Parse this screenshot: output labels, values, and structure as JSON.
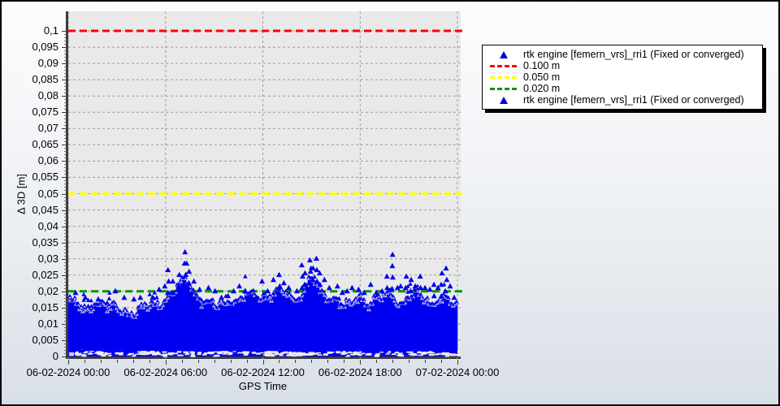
{
  "window": {
    "border_color": "#000000",
    "plot_background": "#e9e9e9",
    "page_background_top": "#fcfdfe",
    "page_background_bottom": "#d9dfe8"
  },
  "chart_data": {
    "type": "scatter",
    "title": "",
    "xlabel": "GPS Time",
    "ylabel": "Δ 3D [m]",
    "x_tick_labels": [
      "06-02-2024 00:00",
      "06-02-2024 06:00",
      "06-02-2024 12:00",
      "06-02-2024 18:00",
      "07-02-2024 00:00"
    ],
    "x_span_hours": 24,
    "x_minor_tick_hours": 1,
    "ylim": [
      0,
      0.106
    ],
    "y_tick_step": 0.005,
    "y_tick_labels": [
      "0",
      "0,005",
      "0,01",
      "0,015",
      "0,02",
      "0,025",
      "0,03",
      "0,035",
      "0,04",
      "0,045",
      "0,05",
      "0,055",
      "0,06",
      "0,065",
      "0,07",
      "0,075",
      "0,08",
      "0,085",
      "0,09",
      "0,095",
      "0,1"
    ],
    "grid": {
      "show": true,
      "style": "dashed",
      "color": "#9b9b9b"
    },
    "series": [
      {
        "name": "rtk engine [femern_vrs]_rri1 (Fixed or converged)",
        "marker": "triangle",
        "color": "#0000f0",
        "description": "Dense ~24 h scatter of 3D position deltas; bulk between 0.000 and 0.020 m, jagged envelope around 0.015-0.020 m, occasional spikes up to 0.033 m"
      }
    ],
    "thresholds": [
      {
        "label": "0.100 m",
        "value": 0.1,
        "color": "#ff0000"
      },
      {
        "label": "0.050 m",
        "value": 0.05,
        "color": "#ffff00"
      },
      {
        "label": "0.020 m",
        "value": 0.02,
        "color": "#009600"
      }
    ],
    "bulk_floor_m": 0.002,
    "envelope_m_by_halfhour": [
      0.017,
      0.018,
      0.016,
      0.017,
      0.016,
      0.015,
      0.016,
      0.015,
      0.014,
      0.015,
      0.016,
      0.017,
      0.019,
      0.021,
      0.024,
      0.022,
      0.019,
      0.018,
      0.017,
      0.016,
      0.017,
      0.019,
      0.022,
      0.019,
      0.018,
      0.019,
      0.022,
      0.021,
      0.017,
      0.019,
      0.026,
      0.022,
      0.019,
      0.017,
      0.016,
      0.018,
      0.02,
      0.017,
      0.018,
      0.019,
      0.02,
      0.018,
      0.019,
      0.02,
      0.018,
      0.017,
      0.019,
      0.018,
      0.016
    ],
    "outliers_h_m": [
      [
        0.45,
        0.0205
      ],
      [
        1.05,
        0.019
      ],
      [
        1.85,
        0.0185
      ],
      [
        2.9,
        0.021
      ],
      [
        3.45,
        0.019
      ],
      [
        4.05,
        0.0185
      ],
      [
        4.45,
        0.019
      ],
      [
        5.2,
        0.019
      ],
      [
        5.6,
        0.0215
      ],
      [
        5.95,
        0.0225
      ],
      [
        6.15,
        0.0275
      ],
      [
        6.45,
        0.024
      ],
      [
        6.85,
        0.026
      ],
      [
        7.2,
        0.033
      ],
      [
        7.3,
        0.0295
      ],
      [
        7.45,
        0.027
      ],
      [
        7.75,
        0.024
      ],
      [
        8.1,
        0.0215
      ],
      [
        8.65,
        0.022
      ],
      [
        9.05,
        0.021
      ],
      [
        9.45,
        0.019
      ],
      [
        9.85,
        0.0195
      ],
      [
        10.2,
        0.021
      ],
      [
        10.55,
        0.0225
      ],
      [
        10.9,
        0.021
      ],
      [
        11.25,
        0.0195
      ],
      [
        11.6,
        0.019
      ],
      [
        11.95,
        0.024
      ],
      [
        12.3,
        0.021
      ],
      [
        12.65,
        0.0245
      ],
      [
        13.0,
        0.026
      ],
      [
        13.3,
        0.0235
      ],
      [
        13.6,
        0.022
      ],
      [
        14.1,
        0.021
      ],
      [
        14.4,
        0.029
      ],
      [
        14.6,
        0.0265
      ],
      [
        14.9,
        0.0305
      ],
      [
        15.1,
        0.028
      ],
      [
        15.3,
        0.031
      ],
      [
        15.5,
        0.0265
      ],
      [
        15.8,
        0.0245
      ],
      [
        16.1,
        0.022
      ],
      [
        16.6,
        0.0225
      ],
      [
        16.9,
        0.0205
      ],
      [
        17.2,
        0.021
      ],
      [
        17.5,
        0.022
      ],
      [
        17.9,
        0.0215
      ],
      [
        18.25,
        0.0205
      ],
      [
        18.65,
        0.023
      ],
      [
        19.0,
        0.0205
      ],
      [
        19.35,
        0.021
      ],
      [
        19.65,
        0.0255
      ],
      [
        20.0,
        0.0322
      ],
      [
        20.3,
        0.022
      ],
      [
        20.5,
        0.0225
      ],
      [
        20.85,
        0.0255
      ],
      [
        21.15,
        0.0245
      ],
      [
        21.4,
        0.0225
      ],
      [
        21.7,
        0.0255
      ],
      [
        22.0,
        0.022
      ],
      [
        22.3,
        0.0215
      ],
      [
        22.55,
        0.023
      ],
      [
        22.8,
        0.022
      ],
      [
        23.05,
        0.0265
      ],
      [
        23.3,
        0.028
      ],
      [
        23.55,
        0.0225
      ],
      [
        23.8,
        0.019
      ]
    ]
  },
  "legend": {
    "items": [
      {
        "marker": "triangle",
        "color": "#0000e0",
        "label": "rtk engine [femern_vrs]_rri1 (Fixed or converged)"
      },
      {
        "marker": "dash",
        "color": "#ff0000",
        "label": "0.100 m"
      },
      {
        "marker": "dash",
        "color": "#ffff00",
        "label": "0.050 m"
      },
      {
        "marker": "dash",
        "color": "#009600",
        "label": "0.020 m"
      },
      {
        "marker": "triangle",
        "color": "#0000e0",
        "label": "rtk engine [femern_vrs]_rri1 (Fixed or converged)"
      }
    ]
  }
}
